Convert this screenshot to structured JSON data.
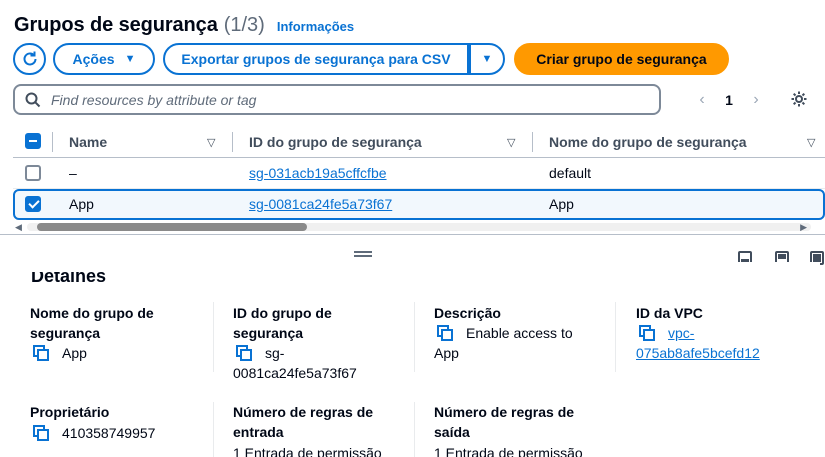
{
  "header": {
    "title": "Grupos de segurança",
    "count": "(1/3)",
    "info": "Informações"
  },
  "toolbar": {
    "actions_label": "Ações",
    "export_label": "Exportar grupos de segurança para CSV",
    "create_label": "Criar grupo de segurança"
  },
  "search": {
    "placeholder": "Find resources by attribute or tag"
  },
  "pagination": {
    "current_page": "1"
  },
  "table": {
    "columns": [
      "Name",
      "ID do grupo de segurança",
      "Nome do grupo de segurança"
    ],
    "rows": [
      {
        "name": "–",
        "id": "sg-031acb19a5cffcfbe",
        "group_name": "default",
        "selected": false
      },
      {
        "name": "App",
        "id": "sg-0081ca24fe5a73f67",
        "group_name": "App",
        "selected": true
      }
    ]
  },
  "details": {
    "title": "Detalhes",
    "fields": {
      "group_name_label_1": "Nome do grupo de",
      "group_name_label_2": "segurança",
      "group_name_value": "App",
      "group_id_label_1": "ID do grupo de",
      "group_id_label_2": "segurança",
      "group_id_value_1": "sg-",
      "group_id_value_2": "0081ca24fe5a73f67",
      "description_label": "Descrição",
      "description_value_1": "Enable access to",
      "description_value_2": "App",
      "vpc_label": "ID da VPC",
      "vpc_value_1": "vpc-",
      "vpc_value_2": "075ab8afe5bcefd12",
      "owner_label": "Proprietário",
      "owner_value": "410358749957",
      "inbound_label_1": "Número de regras de",
      "inbound_label_2": "entrada",
      "inbound_value": "1 Entrada de permissão",
      "outbound_label_1": "Número de regras de",
      "outbound_label_2": "saída",
      "outbound_value": "1 Entrada de permissão"
    }
  },
  "colors": {
    "accent": "#0972d3",
    "primary_button": "#ff9900",
    "text": "#000716"
  }
}
